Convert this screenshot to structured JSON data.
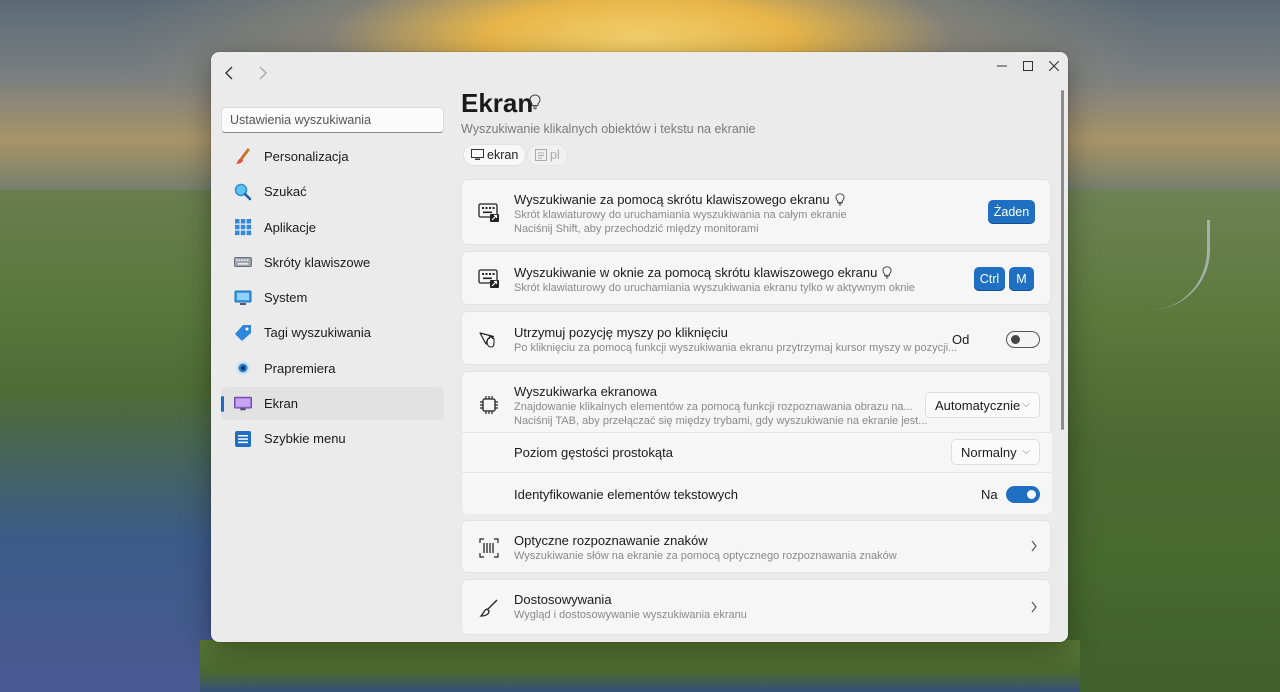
{
  "window": {
    "back_icon": "chevron-left-icon",
    "forward_icon": "chevron-right-icon",
    "minimize": "–",
    "maximize": "☐",
    "close": "✕"
  },
  "search": {
    "placeholder": "Ustawienia wyszukiwania"
  },
  "sidebar": {
    "items": [
      {
        "label": "Personalizacja",
        "icon": "paintbrush-icon"
      },
      {
        "label": "Szukać",
        "icon": "magnifier-icon"
      },
      {
        "label": "Aplikacje",
        "icon": "apps-grid-icon"
      },
      {
        "label": "Skróty klawiszowe",
        "icon": "keyboard-icon"
      },
      {
        "label": "System",
        "icon": "monitor-system-icon"
      },
      {
        "label": "Tagi wyszukiwania",
        "icon": "tag-icon"
      },
      {
        "label": "Prapremiera",
        "icon": "eye-icon"
      },
      {
        "label": "Ekran",
        "icon": "screen-icon",
        "active": true
      },
      {
        "label": "Szybkie menu",
        "icon": "list-menu-icon"
      }
    ]
  },
  "header": {
    "title": "Ekran",
    "subtitle": "Wyszukiwanie klikalnych obiektów i tekstu na ekranie",
    "tags": [
      "ekran",
      "pl"
    ]
  },
  "settings": {
    "shortcut_screen": {
      "title": "Wyszukiwanie za pomocą skrótu klawiszowego ekranu",
      "desc1": "Skrót klawiaturowy do uruchamiania wyszukiwania na całym ekranie",
      "desc2": "Naciśnij Shift, aby przechodzić między monitorami",
      "key": "Żaden"
    },
    "shortcut_window": {
      "title": "Wyszukiwanie w oknie za pomocą skrótu klawiszowego ekranu",
      "desc1": "Skrót klawiaturowy do uruchamiania wyszukiwania ekranu tylko w aktywnym oknie",
      "keys": [
        "Ctrl",
        "M"
      ]
    },
    "mouse_position": {
      "title": "Utrzymuj pozycję myszy po kliknięciu",
      "desc1": "Po kliknięciu za pomocą funkcji wyszukiwania ekranu przytrzymaj kursor myszy w pozycji...",
      "state_label": "Od",
      "enabled": false
    },
    "screen_engine": {
      "title": "Wyszukiwarka ekranowa",
      "desc1": "Znajdowanie klikalnych elementów za pomocą funkcji rozpoznawania obrazu na...",
      "desc2": "Naciśnij TAB, aby przełączać się między trybami, gdy wyszukiwanie na ekranie jest...",
      "value": "Automatycznie",
      "density_label": "Poziom gęstości prostokąta",
      "density_value": "Normalny",
      "text_elements_label": "Identyfikowanie elementów tekstowych",
      "text_elements_state": "Na",
      "text_elements_enabled": true
    },
    "ocr": {
      "title": "Optyczne rozpoznawanie znaków",
      "desc1": "Wyszukiwanie słów na ekranie za pomocą optycznego rozpoznawania znaków"
    },
    "customizations": {
      "title": "Dostosowywania",
      "desc1": "Wygląd i dostosowywanie wyszukiwania ekranu"
    }
  },
  "colors": {
    "accent": "#1f6fc2"
  }
}
